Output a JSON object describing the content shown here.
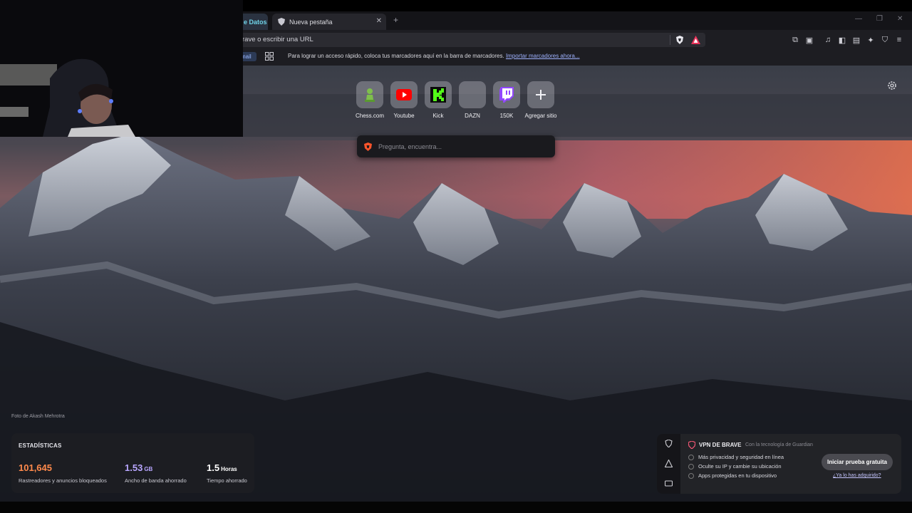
{
  "tabs": [
    {
      "label": "e Datos"
    },
    {
      "label": "Nueva pestaña"
    }
  ],
  "address_bar": {
    "placeholder": "Brave o escribir una URL",
    "display_text": "rave o escribir una URL"
  },
  "bookmarks_bar": {
    "gmail_chip": "mail",
    "hint": "Para lograr un acceso rápido, coloca tus marcadores aquí en la barra de marcadores.",
    "import_link": "Importar marcadores ahora..."
  },
  "top_sites": [
    {
      "label": "Chess.com",
      "icon": "chess-pawn-icon"
    },
    {
      "label": "Youtube",
      "icon": "youtube-icon"
    },
    {
      "label": "Kick",
      "icon": "kick-icon"
    },
    {
      "label": "DAZN",
      "icon": "dazn-icon"
    },
    {
      "label": "150K",
      "icon": "twitch-icon"
    },
    {
      "label": "Agregar sitio",
      "icon": "plus-icon"
    }
  ],
  "search": {
    "placeholder": "Pregunta, encuentra..."
  },
  "photo_credit": "Foto de Akash Mehrotra",
  "stats": {
    "title": "ESTADÍSTICAS",
    "trackers": {
      "value": "101,645",
      "label": "Rastreadores y anuncios bloqueados",
      "color": "#ff8a4c"
    },
    "bandwidth": {
      "value": "1.53",
      "unit": "GB",
      "label": "Ancho de banda ahorrado",
      "color": "#b8a6ff"
    },
    "time": {
      "value": "1.5",
      "unit": "Horas",
      "label": "Tiempo ahorrado",
      "color": "#ffffff"
    }
  },
  "vpn": {
    "title": "VPN DE BRAVE",
    "powered_by": "Con la tecnología de Guardian",
    "features": [
      "Más privacidad y seguridad en línea",
      "Oculte su IP y cambie su ubicación",
      "Apps protegidas en tu dispositivo"
    ],
    "cta": "Iniciar prueba gratuita",
    "link": "¿Ya lo has adquirido?"
  }
}
